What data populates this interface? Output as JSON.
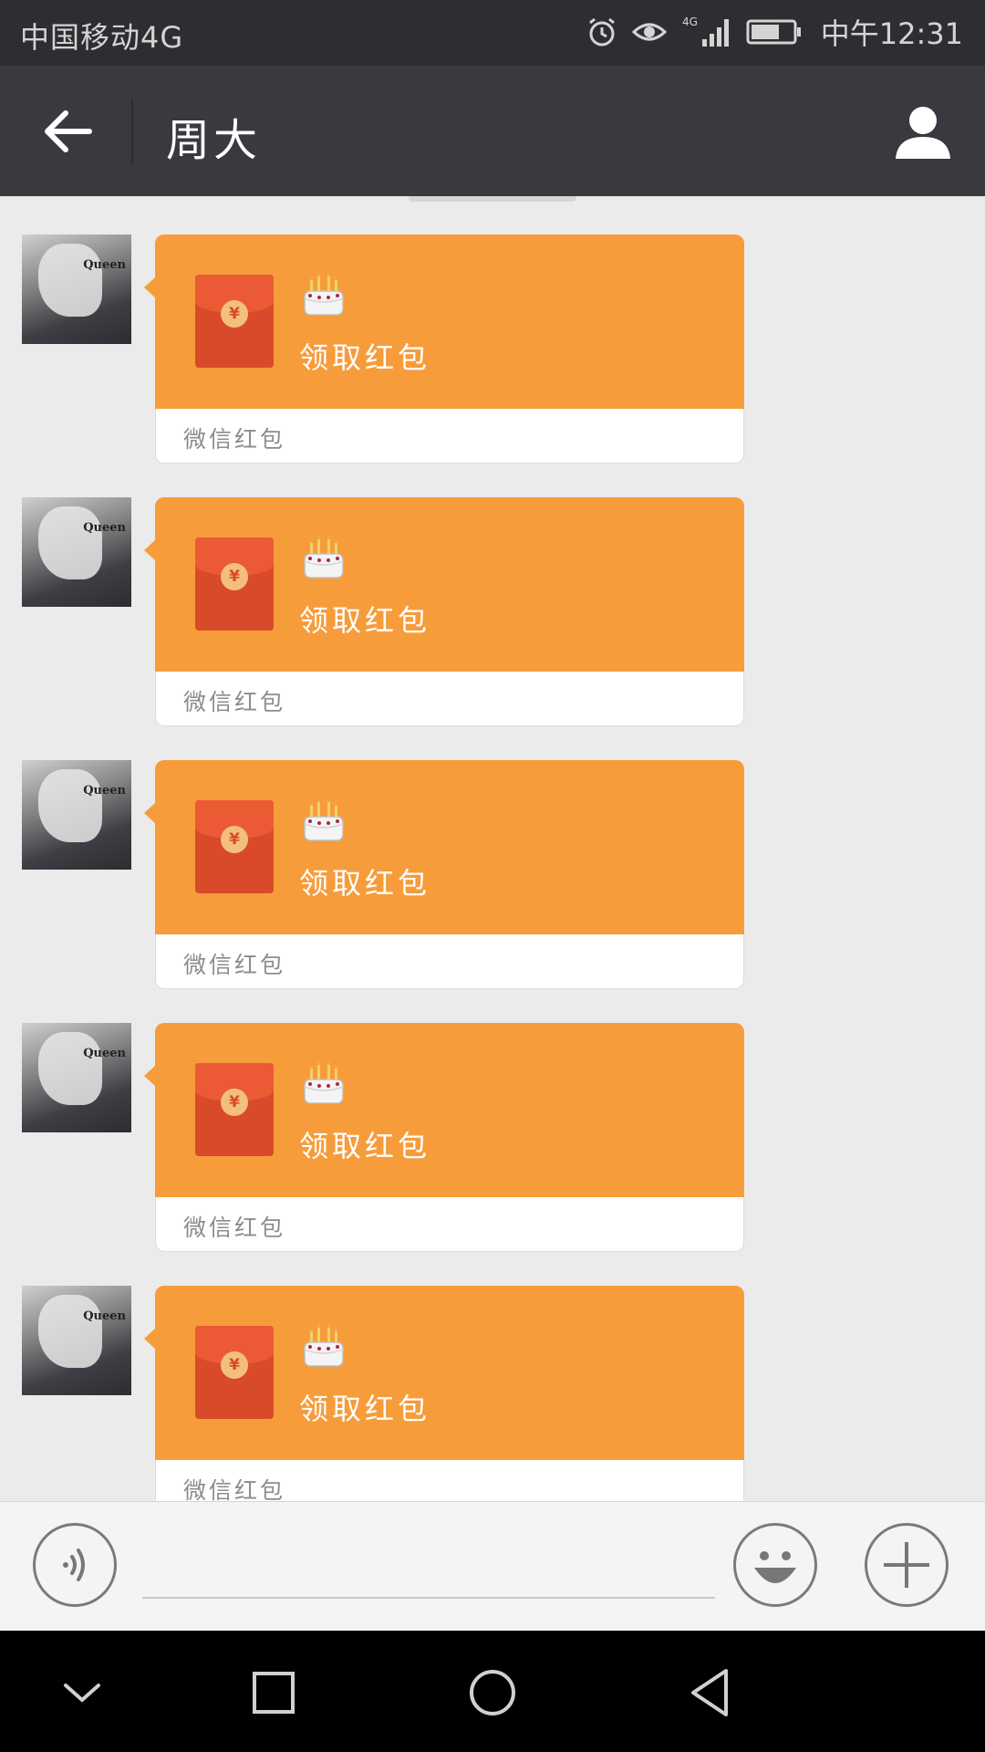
{
  "status_bar": {
    "carrier": "中国移动4G",
    "network_badge": "4G",
    "time": "中午12:31",
    "icons": [
      "alarm-icon",
      "eye-icon",
      "signal-icon",
      "battery-icon"
    ]
  },
  "header": {
    "title": "周大",
    "back_icon": "arrow-left-icon",
    "profile_icon": "person-icon"
  },
  "messages": [
    {
      "avatar_text": "Queen",
      "emoji": "birthday-cake",
      "action_label": "领取红包",
      "footer_label": "微信红包"
    },
    {
      "avatar_text": "Queen",
      "emoji": "birthday-cake",
      "action_label": "领取红包",
      "footer_label": "微信红包"
    },
    {
      "avatar_text": "Queen",
      "emoji": "birthday-cake",
      "action_label": "领取红包",
      "footer_label": "微信红包"
    },
    {
      "avatar_text": "Queen",
      "emoji": "birthday-cake",
      "action_label": "领取红包",
      "footer_label": "微信红包"
    },
    {
      "avatar_text": "Queen",
      "emoji": "birthday-cake",
      "action_label": "领取红包",
      "footer_label": "微信红包"
    }
  ],
  "input_bar": {
    "voice_icon": "voice-icon",
    "emoji_icon": "smiley-icon",
    "plus_icon": "plus-icon",
    "placeholder": ""
  },
  "nav_bar": {
    "icons": [
      "chevron-down-icon",
      "square-icon",
      "circle-icon",
      "triangle-back-icon"
    ]
  },
  "colors": {
    "status_bar_bg": "#2d2e31",
    "header_bg": "#393a3f",
    "chat_bg": "#ebebeb",
    "red_packet_bg": "#f79c3b",
    "envelope_red": "#d94a2a"
  }
}
